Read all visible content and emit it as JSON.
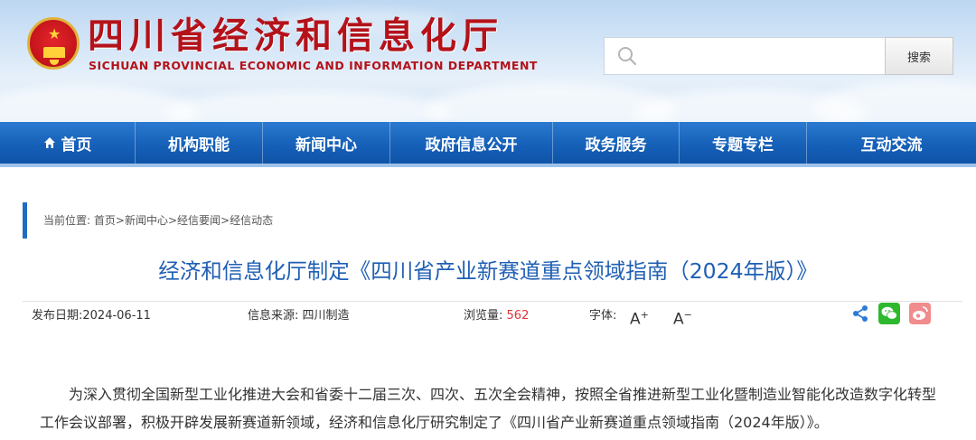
{
  "header": {
    "site_title": "四川省经济和信息化厅",
    "site_subtitle": "SICHUAN PROVINCIAL ECONOMIC AND INFORMATION DEPARTMENT",
    "search": {
      "placeholder": "",
      "value": "",
      "button_label": "搜索"
    }
  },
  "nav": {
    "items": [
      {
        "label": "首页",
        "icon": "home-icon"
      },
      {
        "label": "机构职能"
      },
      {
        "label": "新闻中心"
      },
      {
        "label": "政府信息公开"
      },
      {
        "label": "政务服务"
      },
      {
        "label": "专题专栏"
      },
      {
        "label": "互动交流"
      }
    ]
  },
  "breadcrumb": {
    "prefix": "当前位置:",
    "items": [
      "首页",
      "新闻中心",
      "经信要闻",
      "经信动态"
    ],
    "separator": ">"
  },
  "article": {
    "title": "经济和信息化厅制定《四川省产业新赛道重点领域指南（2024年版）》",
    "meta": {
      "date_label": "发布日期:",
      "date": "2024-06-11",
      "source_label": "信息来源:",
      "source": "四川制造",
      "views_label": "浏览量:",
      "views": "562",
      "font_label": "字体:",
      "font_increase": "A",
      "font_increase_sign": "+",
      "font_decrease": "A",
      "font_decrease_sign": "−"
    },
    "share": {
      "icons": [
        "share-icon",
        "wechat-icon",
        "weibo-icon"
      ]
    },
    "body": "为深入贯彻全国新型工业化推进大会和省委十二届三次、四次、五次全会精神，按照全省推进新型工业化暨制造业智能化改造数字化转型工作会议部署，积极开辟发展新赛道新领域，经济和信息化厅研究制定了《四川省产业新赛道重点领域指南（2024年版）》。"
  },
  "colors": {
    "brand_red": "#b4121a",
    "nav_blue": "#1660b8",
    "title_blue": "#1f5fb3",
    "views_red": "#e0323a"
  }
}
